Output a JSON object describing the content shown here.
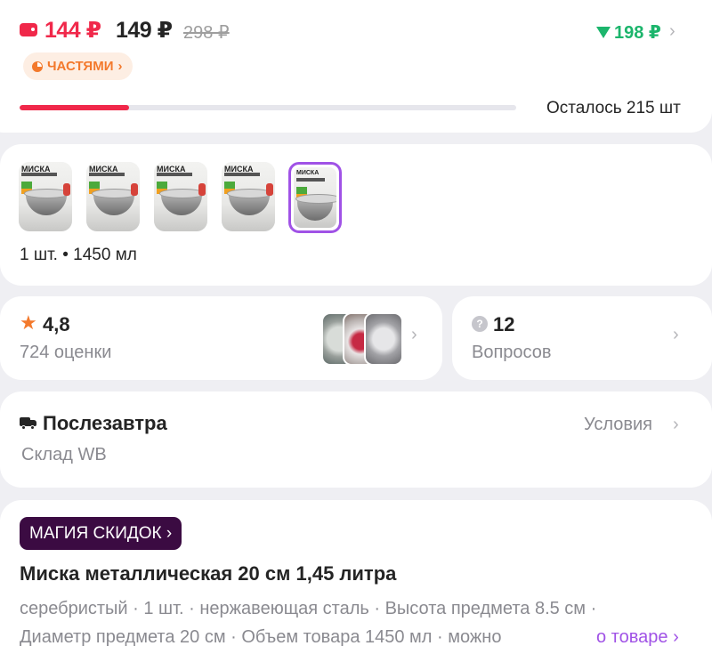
{
  "price": {
    "wallet_price": "144 ₽",
    "price": "149 ₽",
    "old_price": "298 ₽",
    "price_drop": "198 ₽",
    "installments_label": "ЧАСТЯМИ",
    "stock_progress_percent": 22,
    "stock_text": "Осталось 215 шт"
  },
  "variants": {
    "thumb_title": "МИСКА",
    "selected_index": 4,
    "count": 5,
    "caption": "1 шт. • 1450 мл"
  },
  "rating": {
    "value": "4,8",
    "count_label": "724 оценки"
  },
  "questions": {
    "count": "12",
    "label": "Вопросов"
  },
  "delivery": {
    "date": "Послезавтра",
    "terms_label": "Условия",
    "warehouse": "Склад WB"
  },
  "product": {
    "promo_badge": "МАГИЯ СКИДОК ›",
    "title": "Миска металлическая 20 см 1,45 литра",
    "attrs_line1": "серебристый · 1 шт. · нержавеющая сталь · Высота предмета 8.5 см ·",
    "attrs_line2": "Диаметр предмета 20 см · Объем товара 1450 мл · можно",
    "about_link": "о товаре ›"
  },
  "colors": {
    "accent_pink": "#f0284a",
    "price_drop_green": "#1cb56c",
    "installments_orange": "#f3792c",
    "selection_purple": "#a052e6",
    "promo_bg": "#3b0b42"
  },
  "icons": {
    "wallet": "wallet-icon",
    "down": "triangle-down-icon",
    "chevron": "chevron-right-icon",
    "star": "star-icon",
    "question": "question-bubble-icon",
    "truck": "truck-icon"
  }
}
